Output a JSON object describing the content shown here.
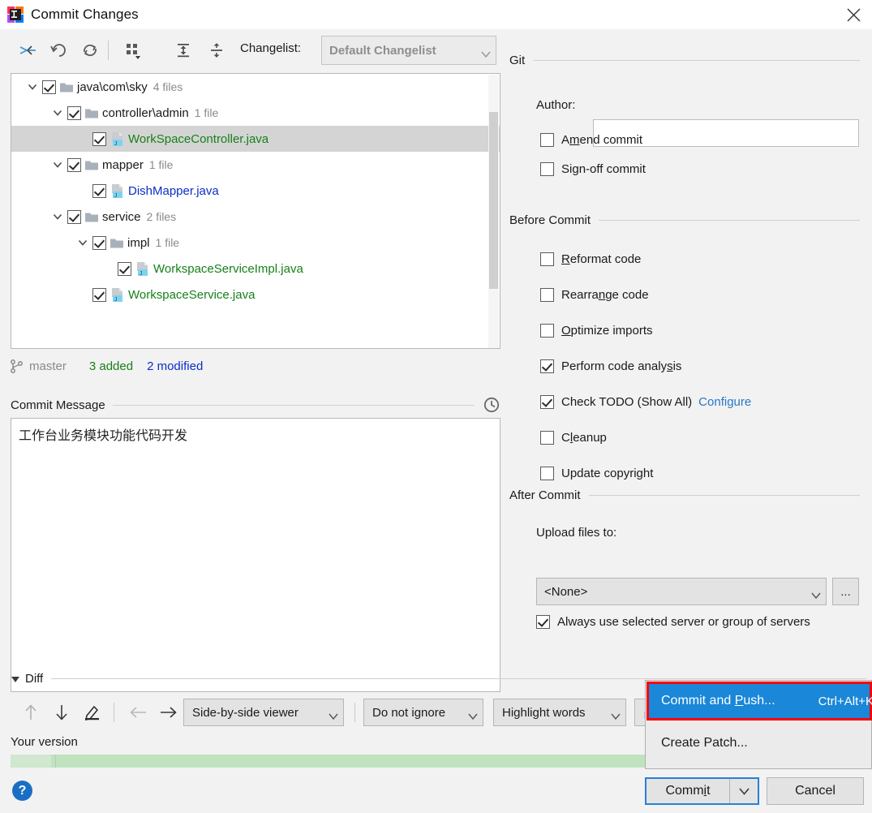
{
  "window": {
    "title": "Commit Changes",
    "logo_icon": "intellij-idea-logo",
    "close_icon": "close-icon"
  },
  "toolbar": {
    "icons": [
      {
        "name": "move-to-changelist-icon",
        "label": "move-to-changelist"
      },
      {
        "name": "revert-icon",
        "label": "revert"
      },
      {
        "name": "refresh-icon",
        "label": "refresh"
      },
      {
        "name": "group-by-icon",
        "label": "group-by"
      },
      {
        "name": "expand-all-icon",
        "label": "expand-all"
      },
      {
        "name": "collapse-all-icon",
        "label": "collapse-all"
      }
    ],
    "changelist_label": "Changelist:",
    "changelist_value": "Default Changelist"
  },
  "tree": {
    "rows": [
      {
        "indent": 0,
        "twisty": "down",
        "checked": true,
        "kind": "folder",
        "name": "java\\com\\sky",
        "count": "4 files",
        "color": "default",
        "selected": false
      },
      {
        "indent": 1,
        "twisty": "down",
        "checked": true,
        "kind": "folder",
        "name": "controller\\admin",
        "count": "1 file",
        "color": "default",
        "selected": false
      },
      {
        "indent": 2,
        "twisty": "none",
        "checked": true,
        "kind": "java",
        "name": "WorkSpaceController.java",
        "count": "",
        "color": "green",
        "selected": true
      },
      {
        "indent": 1,
        "twisty": "down",
        "checked": true,
        "kind": "folder",
        "name": "mapper",
        "count": "1 file",
        "color": "default",
        "selected": false
      },
      {
        "indent": 2,
        "twisty": "none",
        "checked": true,
        "kind": "java",
        "name": "DishMapper.java",
        "count": "",
        "color": "blue",
        "selected": false
      },
      {
        "indent": 1,
        "twisty": "down",
        "checked": true,
        "kind": "folder",
        "name": "service",
        "count": "2 files",
        "color": "default",
        "selected": false
      },
      {
        "indent": 2,
        "twisty": "down",
        "checked": true,
        "kind": "folder",
        "name": "impl",
        "count": "1 file",
        "color": "default",
        "selected": false
      },
      {
        "indent": 3,
        "twisty": "none",
        "checked": true,
        "kind": "java",
        "name": "WorkspaceServiceImpl.java",
        "count": "",
        "color": "green",
        "selected": false
      },
      {
        "indent": 2,
        "twisty": "none",
        "checked": true,
        "kind": "java",
        "name": "WorkspaceService.java",
        "count": "",
        "color": "green",
        "selected": false
      }
    ]
  },
  "status": {
    "branch_icon": "git-branch-icon",
    "branch": "master",
    "added": "3 added",
    "modified": "2 modified"
  },
  "commit_message": {
    "label": "Commit Message",
    "history_icon": "clock-history-icon",
    "value": "工作台业务模块功能代码开发"
  },
  "git_section": {
    "title": "Git",
    "author_label": "Author:",
    "author_value": "",
    "options": [
      {
        "label_pre": "A",
        "label_mn": "m",
        "label_post": "end commit",
        "checked": false,
        "name": "amend-commit"
      },
      {
        "label_pre": "Si",
        "label_mn": "g",
        "label_post": "n-off commit",
        "checked": false,
        "name": "sign-off-commit"
      }
    ]
  },
  "before_commit": {
    "title": "Before Commit",
    "options": [
      {
        "label_pre": "",
        "label_mn": "R",
        "label_post": "eformat code",
        "checked": false,
        "name": "reformat-code"
      },
      {
        "label_pre": "Rearra",
        "label_mn": "n",
        "label_post": "ge code",
        "checked": false,
        "name": "rearrange-code"
      },
      {
        "label_pre": "",
        "label_mn": "O",
        "label_post": "ptimize imports",
        "checked": false,
        "name": "optimize-imports"
      },
      {
        "label_pre": "Perform code analy",
        "label_mn": "s",
        "label_post": "is",
        "checked": true,
        "name": "perform-code-analysis"
      },
      {
        "label_pre": "Check TODO (Show All)",
        "label_mn": "",
        "label_post": "",
        "checked": true,
        "name": "check-todo",
        "link": "Configure"
      },
      {
        "label_pre": "C",
        "label_mn": "l",
        "label_post": "eanup",
        "checked": false,
        "name": "cleanup"
      },
      {
        "label_pre": "Update copyright",
        "label_mn": "",
        "label_post": "",
        "checked": false,
        "name": "update-copyright"
      }
    ]
  },
  "after_commit": {
    "title": "After Commit",
    "upload_label": "Upload files to:",
    "upload_value": "<None>",
    "browse_label": "...",
    "always_use_label": "Always use selected server or group of servers",
    "always_use_checked": true
  },
  "diff": {
    "title": "Diff",
    "nav_icons": [
      {
        "name": "previous-difference-icon",
        "glyph": "↑"
      },
      {
        "name": "next-difference-icon",
        "glyph": "↓"
      },
      {
        "name": "edit-source-icon",
        "glyph": "✎"
      },
      {
        "name": "accept-left-icon",
        "glyph": "←"
      },
      {
        "name": "accept-right-icon",
        "glyph": "→"
      }
    ],
    "viewer_mode": "Side-by-side viewer",
    "ignore_policy": "Do not ignore",
    "highlight_policy": "Highlight words",
    "lock_icon": "lock-icon",
    "your_version_label": "Your version"
  },
  "popup_menu": {
    "items": [
      {
        "label_pre": "Commit and ",
        "label_mn": "P",
        "label_post": "ush...",
        "shortcut": "Ctrl+Alt+K",
        "highlighted": true,
        "name": "commit-and-push"
      },
      {
        "label_pre": "Create Patch...",
        "label_mn": "",
        "label_post": "",
        "shortcut": "",
        "highlighted": false,
        "name": "create-patch"
      }
    ]
  },
  "footer": {
    "help_label": "?",
    "commit_pre": "Comm",
    "commit_mn": "i",
    "commit_post": "t",
    "cancel_label": "Cancel"
  },
  "colors": {
    "accent": "#1a87d8",
    "highlight_outline": "#fb0007",
    "added_green": "#17801a",
    "modified_blue": "#0b2ec7",
    "link_blue": "#2878c8",
    "diff_green": "#bfe3bf"
  }
}
